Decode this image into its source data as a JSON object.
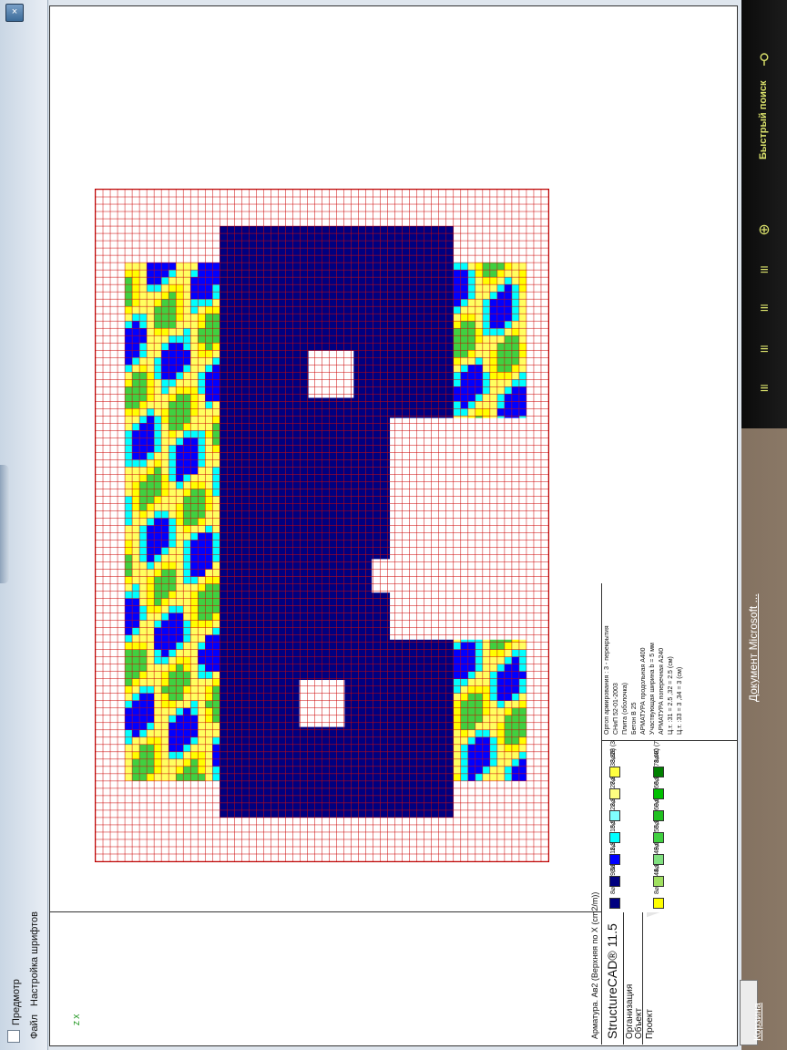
{
  "window": {
    "menu": [
      "Файл",
      "Настройка шрифтов"
    ],
    "preview_label": "Предмотр",
    "close_label": "×"
  },
  "document": {
    "drawing_title": "Арматура. Ав2 (Верхняя по X (cm2/m))",
    "app_name": "StructureCAD® 11.5",
    "rows": [
      "Организация",
      "Объект",
      "Проект"
    ],
    "axes_label": "Z X"
  },
  "legend": [
    {
      "label": "8⌀12 (9,51)",
      "color": "#000080"
    },
    {
      "label": "8⌀32 (44,12)",
      "color": "#ffff00"
    },
    {
      "label": "8⌀12 (11,31)",
      "color": "#000080"
    },
    {
      "label": "8⌀32 (49,63)",
      "color": "#a0e060"
    },
    {
      "label": "8⌀16 (15,54)",
      "color": "#0000ff"
    },
    {
      "label": "8⌀36 (55,14)",
      "color": "#80e080"
    },
    {
      "label": "8⌀20 (22,35)",
      "color": "#00ffff"
    },
    {
      "label": "8⌀36 (60,65)",
      "color": "#40d040"
    },
    {
      "label": "8⌀22 (27,87)",
      "color": "#80ffff"
    },
    {
      "label": "8⌀36 (66,17)",
      "color": "#20c020"
    },
    {
      "label": "8⌀25 (33,38)",
      "color": "#ffff80"
    },
    {
      "label": "8⌀40 (71,68)",
      "color": "#00c000"
    },
    {
      "label": "8⌀28 (38,9)",
      "color": "#ffff40"
    },
    {
      "label": "8⌀40 (77,2)",
      "color": "#008000"
    }
  ],
  "notes": [
    "Ортоп армирования : 3 - перекрытия",
    "СНиП 52-01-2003",
    "Плита (оболочка)",
    "Бетон B 25",
    "АРМАТУРА продольная A400",
    "Участвующая ширина b = 5 мм",
    "АРМАТУРА поперечная A240",
    "Ц.т. :З1 =  2.5 ,З2 =  2.5 (см)",
    "Ц.т. :З3 =  3 ,З4 =  3 (см)"
  ],
  "gadget": {
    "search_label": "Быстрый поиск",
    "icons": [
      "search-icon",
      "zoom-in-icon",
      "list-icon",
      "list-icon",
      "close-list-icon",
      "add-list-icon"
    ]
  },
  "taskbar": {
    "doc_item": "Документ Microsoft ...",
    "bottom_item": "Корзина"
  },
  "colors": {
    "dark_blue": "#000080",
    "blue": "#0000ff",
    "cyan": "#00ffff",
    "yellow": "#ffff00",
    "green": "#40d040",
    "grid": "#cc0000"
  }
}
